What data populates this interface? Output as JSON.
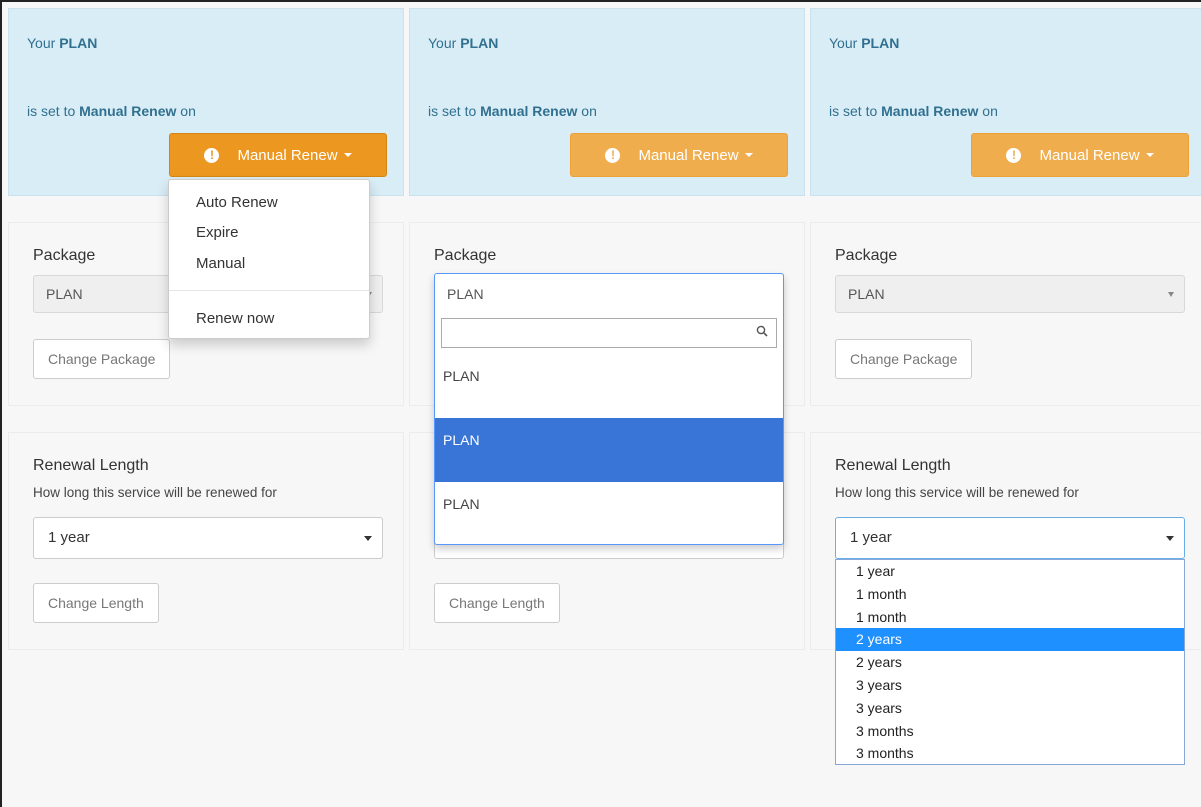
{
  "plan_box": {
    "your": "Your",
    "plan": "PLAN",
    "set_to": "is set to",
    "manual_renew_bold": "Manual Renew",
    "on": "on",
    "button_label": "Manual Renew"
  },
  "renew_menu": {
    "items": [
      "Auto Renew",
      "Expire",
      "Manual"
    ],
    "renew_now": "Renew now"
  },
  "package": {
    "label": "Package",
    "selected": "PLAN",
    "change_button": "Change Package",
    "options": [
      "PLAN",
      "PLAN",
      "PLAN"
    ],
    "highlighted_index": 1
  },
  "renewal": {
    "label": "Renewal Length",
    "help": "How long this service will be renewed for",
    "selected": "1 year",
    "change_button": "Change Length",
    "options": [
      "1 year",
      "1 month",
      "1 month",
      "2 years",
      "2 years",
      "3 years",
      "3 years",
      "3 months",
      "3 months"
    ],
    "selected_option_index": 3
  },
  "colors": {
    "warning": "#f0ad4e",
    "warning_active": "#ec971f",
    "info_bg": "#d9edf7",
    "info_text": "#31708f",
    "highlight": "#3875d7",
    "native_highlight": "#1e90ff"
  }
}
